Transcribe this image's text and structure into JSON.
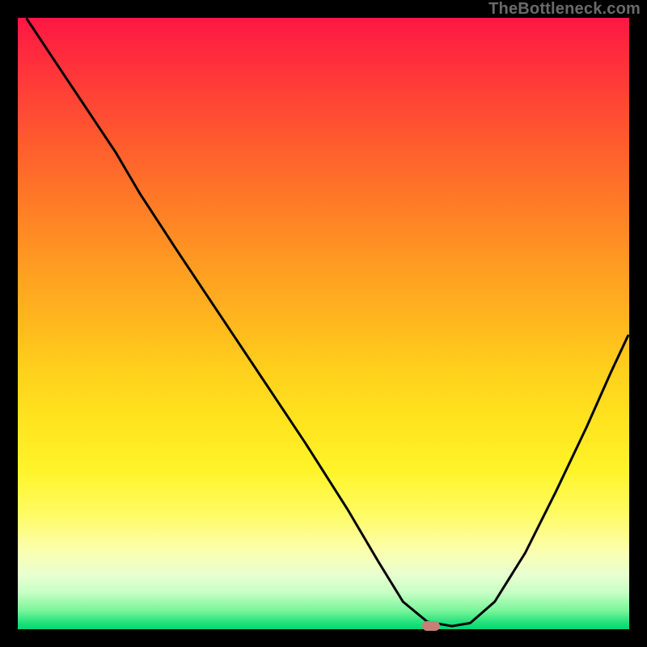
{
  "attribution": {
    "text": "TheBottleneck.com"
  },
  "marker": {
    "color": "#c97e77",
    "x_fraction": 0.676,
    "y_fraction": 0.995
  },
  "chart_data": {
    "type": "line",
    "title": "",
    "xlabel": "",
    "ylabel": "",
    "xlim": [
      0,
      1
    ],
    "ylim": [
      0,
      1
    ],
    "legend": false,
    "grid": false,
    "background": "red-yellow-green vertical gradient",
    "note": "Axes unlabeled; values are fractional plot coordinates with y=0 at bottom, y=1 at top.",
    "series": [
      {
        "name": "curve",
        "color": "#000000",
        "x": [
          0.015,
          0.06,
          0.11,
          0.16,
          0.2,
          0.26,
          0.33,
          0.4,
          0.47,
          0.54,
          0.59,
          0.63,
          0.67,
          0.71,
          0.74,
          0.78,
          0.83,
          0.88,
          0.93,
          0.97,
          0.998
        ],
        "y": [
          0.998,
          0.93,
          0.855,
          0.78,
          0.712,
          0.62,
          0.515,
          0.41,
          0.305,
          0.195,
          0.11,
          0.045,
          0.012,
          0.005,
          0.01,
          0.045,
          0.125,
          0.225,
          0.33,
          0.42,
          0.48
        ]
      }
    ],
    "annotations": [
      {
        "type": "marker",
        "shape": "rounded-rect",
        "color": "#c97e77",
        "x": 0.676,
        "y": 0.005
      }
    ]
  }
}
